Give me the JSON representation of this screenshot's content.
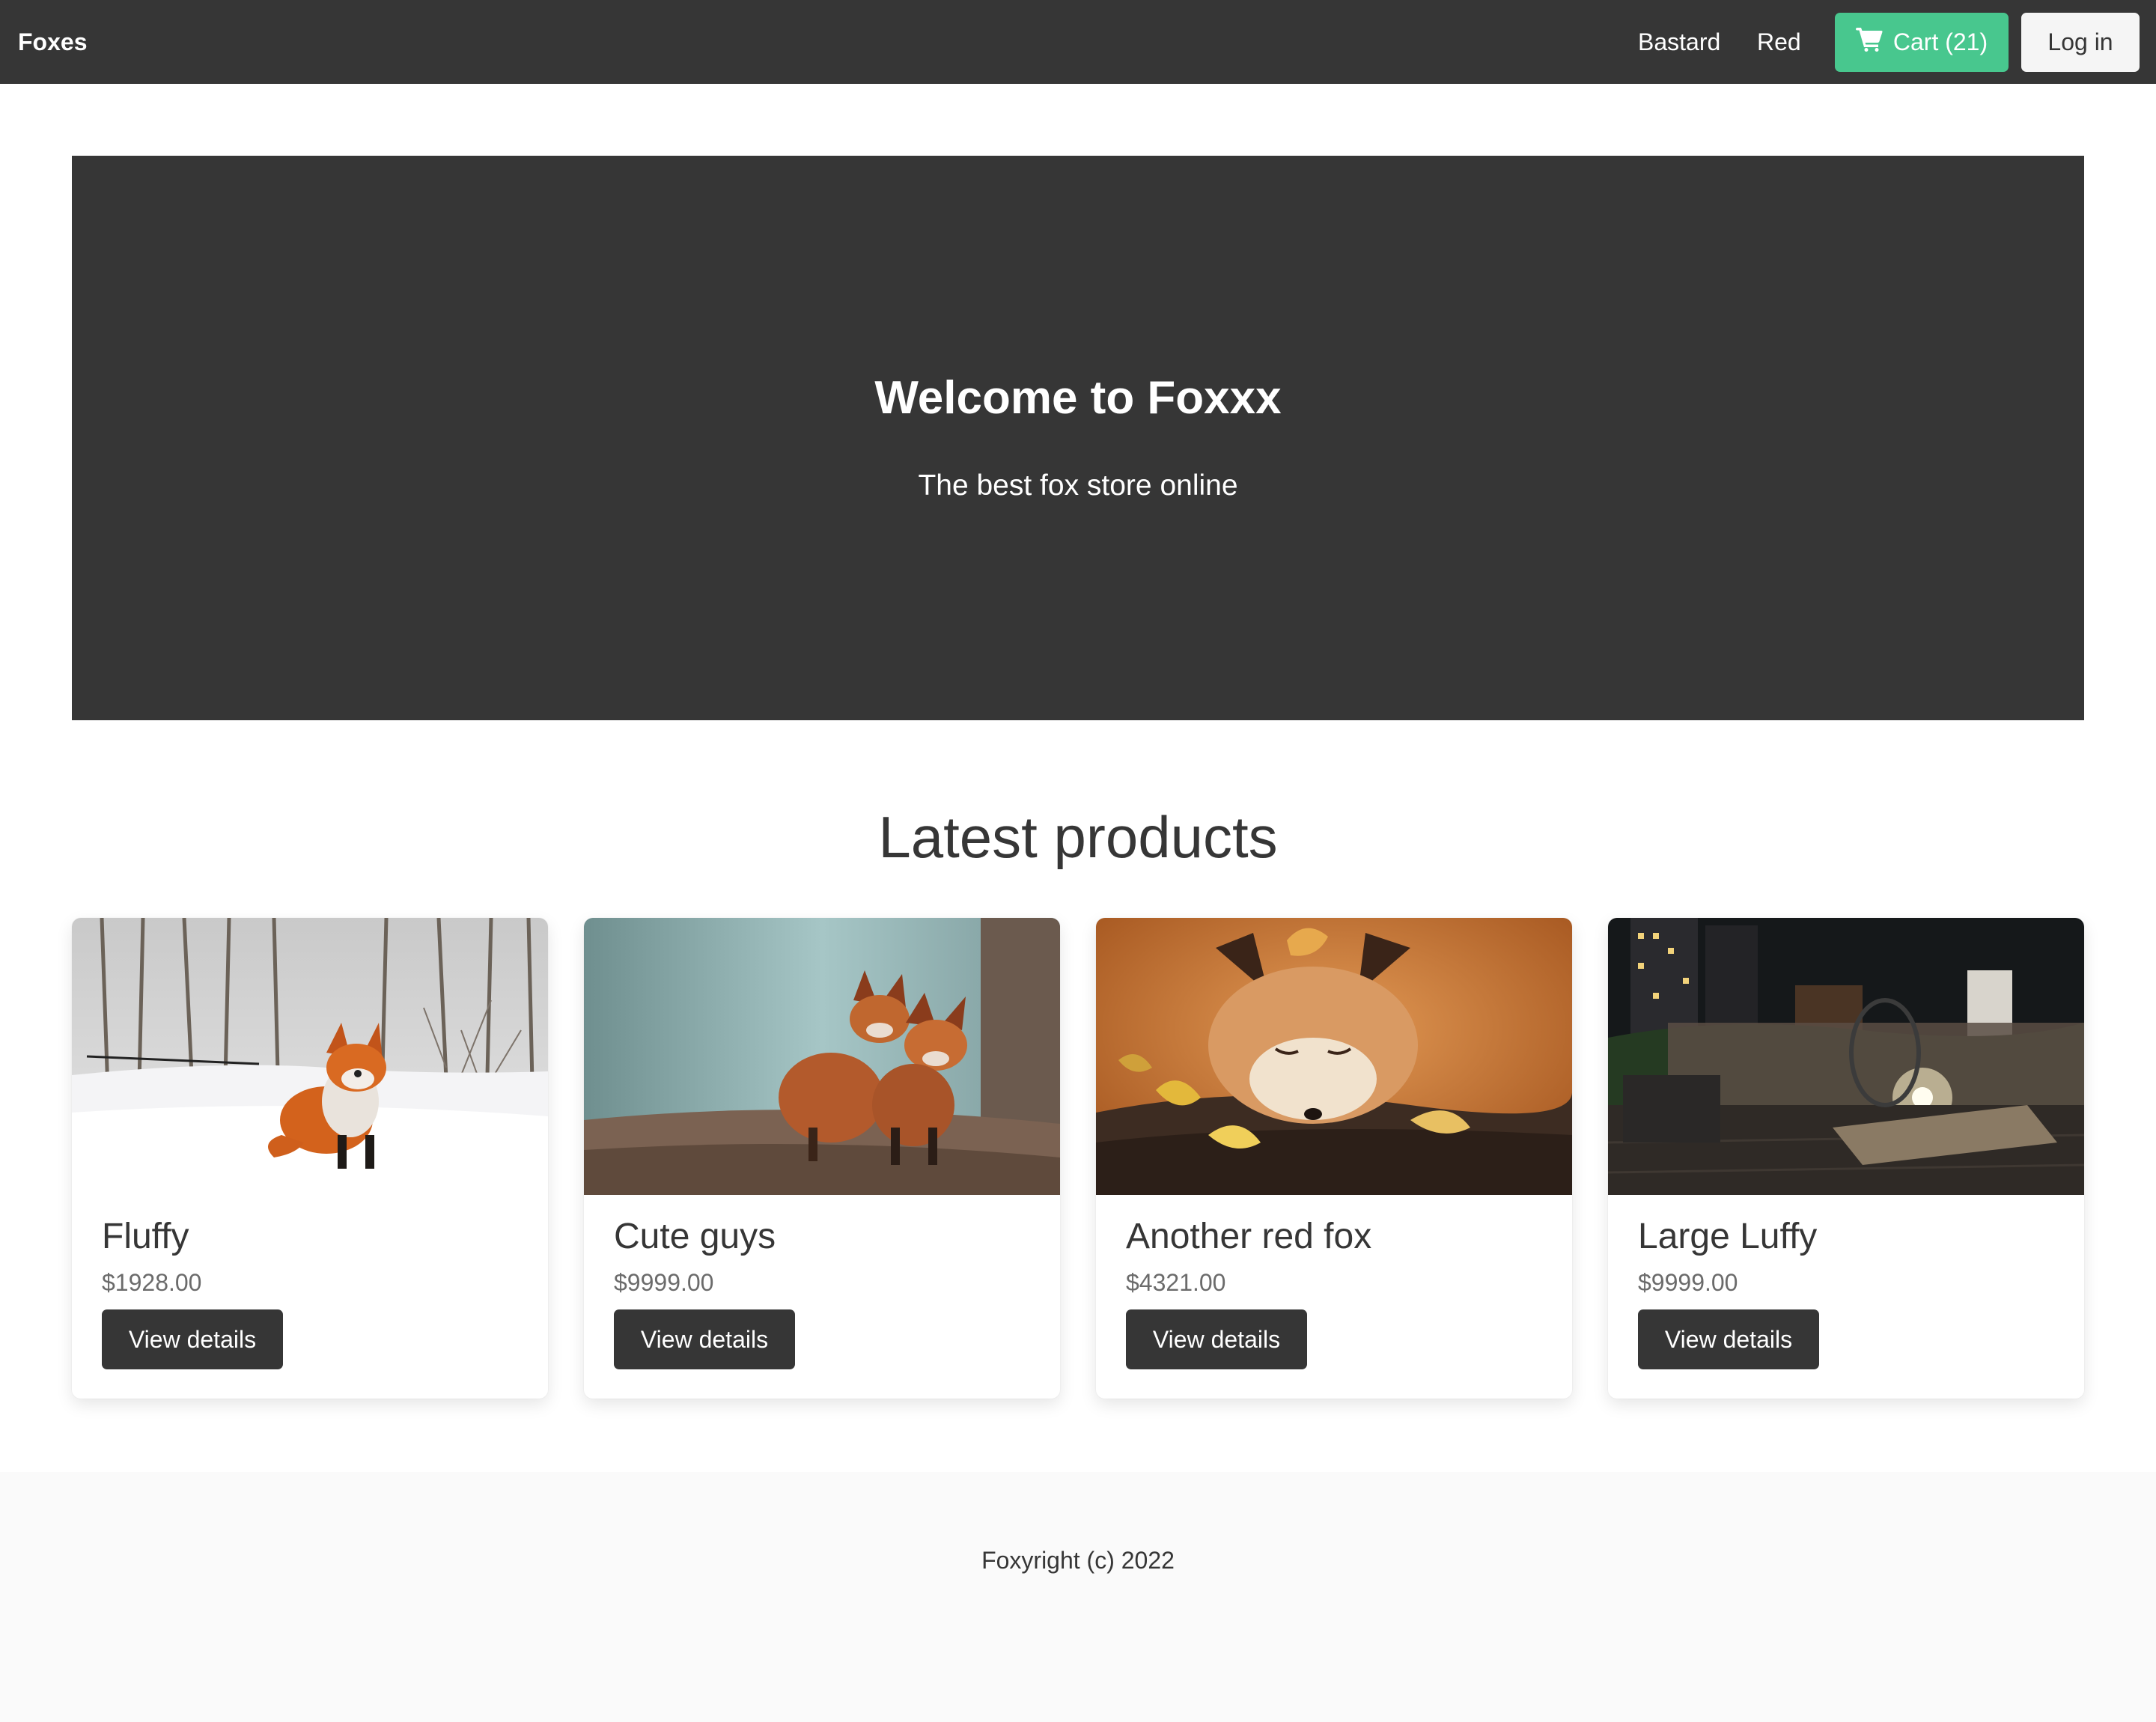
{
  "navbar": {
    "brand": "Foxes",
    "links": [
      "Bastard",
      "Red"
    ],
    "cart_label": "Cart (21)",
    "login_label": "Log in",
    "cart_icon": "shopping-cart-icon",
    "bg_color": "#363636",
    "cart_color": "#48c78e"
  },
  "hero": {
    "title": "Welcome to Foxxx",
    "subtitle": "The best fox store online"
  },
  "products": {
    "section_title": "Latest products",
    "items": [
      {
        "name": "Fluffy",
        "price": "$1928.00",
        "button": "View details"
      },
      {
        "name": "Cute guys",
        "price": "$9999.00",
        "button": "View details"
      },
      {
        "name": "Another red fox",
        "price": "$4321.00",
        "button": "View details"
      },
      {
        "name": "Large Luffy",
        "price": "$9999.00",
        "button": "View details"
      }
    ]
  },
  "footer": {
    "text": "Foxyright (c) 2022"
  }
}
